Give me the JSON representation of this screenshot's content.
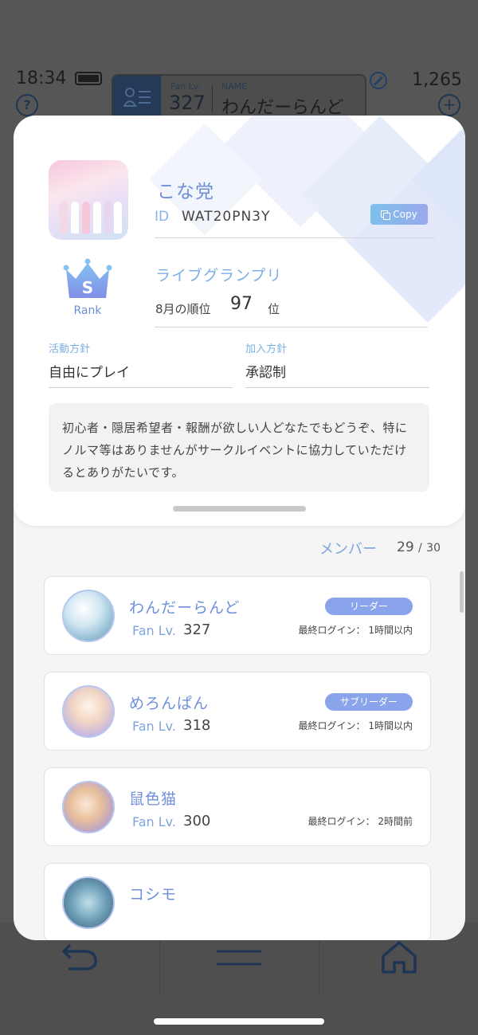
{
  "status": {
    "time": "18:34"
  },
  "header": {
    "help": "?",
    "fan_lv_label": "Fan Lv.",
    "fan_lv_value": "327",
    "name_label": "NAME",
    "name_value": "わんだーらんど",
    "coins": "1,265",
    "plus": "+"
  },
  "circle": {
    "name": "こな党",
    "id_label": "ID",
    "id_value": "WAT20PN3Y",
    "copy_label": "Copy",
    "rank_letter": "S",
    "rank_label": "Rank",
    "gp_title": "ライブグランプリ",
    "gp_month": "8月の順位",
    "gp_rank": "97",
    "gp_unit": "位",
    "activity_label": "活動方針",
    "activity_value": "自由にプレイ",
    "join_label": "加入方針",
    "join_value": "承認制",
    "description": "初心者・隠居希望者・報酬が欲しい人どなたでもどうぞ、特にノルマ等はありませんがサークルイベントに協力していただけるとありがたいです。"
  },
  "members": {
    "label": "メンバー",
    "count": "29",
    "sep": "/",
    "max": "30",
    "fan_lv_label": "Fan Lv.",
    "items": [
      {
        "name": "わんだーらんど",
        "fan_lv": "327",
        "role": "リーダー",
        "login": "最終ログイン： 1時間以内"
      },
      {
        "name": "めろんぱん",
        "fan_lv": "318",
        "role": "サブリーダー",
        "login": "最終ログイン： 1時間以内"
      },
      {
        "name": "鼠色猫",
        "fan_lv": "300",
        "role": "",
        "login": "最終ログイン： 2時間前"
      },
      {
        "name": "コシモ",
        "fan_lv": "",
        "role": "",
        "login": ""
      }
    ]
  },
  "nav": {
    "items": [
      "back-icon",
      "menu-icon",
      "home-icon"
    ]
  },
  "colors": {
    "accent": "#7ea4df",
    "role_badge": "#8aa4ec",
    "overlay": "#565656"
  }
}
